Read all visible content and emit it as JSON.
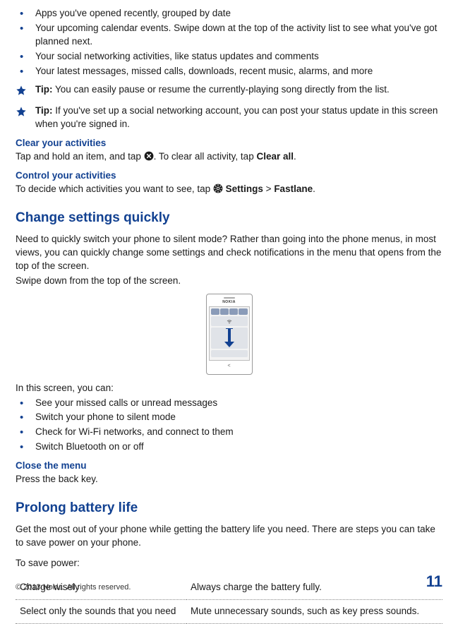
{
  "bullets1": [
    "Apps you've opened recently, grouped by date",
    "Your upcoming calendar events. Swipe down at the top of the activity list to see what you've got planned next.",
    "Your social networking activities, like status updates and comments",
    "Your latest messages, missed calls, downloads, recent music, alarms, and more"
  ],
  "tips": [
    {
      "label": "Tip:",
      "text": " You can easily pause or resume the currently-playing song directly from the list."
    },
    {
      "label": "Tip:",
      "text": " If you've set up a social networking account, you can post your status update in this screen when you're signed in."
    }
  ],
  "clear": {
    "heading": "Clear your activities",
    "line_a": "Tap and hold an item, and tap ",
    "line_b": ". To clear all activity, tap ",
    "clear_all": "Clear all",
    "dot": "."
  },
  "control": {
    "heading": "Control your activities",
    "line_a": "To decide which activities you want to see, tap ",
    "settings": " Settings",
    "gt": " > ",
    "fastlane": "Fastlane",
    "dot": "."
  },
  "change": {
    "heading": "Change settings quickly",
    "intro": "Need to quickly switch your phone to silent mode? Rather than going into the phone menus, in most views, you can quickly change some settings and check notifications in the menu that opens from the top of the screen.",
    "swipe": "Swipe down from the top of the screen.",
    "inthis": "In this screen, you can:",
    "bullets": [
      "See your missed calls or unread messages",
      "Switch your phone to silent mode",
      "Check for Wi-Fi networks, and connect to them",
      "Switch Bluetooth on or off"
    ],
    "close_heading": "Close the menu",
    "close_text": "Press the back key."
  },
  "battery": {
    "heading": "Prolong battery life",
    "intro": "Get the most out of your phone while getting the battery life you need. There are steps you can take to save power on your phone.",
    "tosave": "To save power:",
    "rows": [
      {
        "left": "Charge wisely",
        "right": "Always charge the battery fully."
      },
      {
        "left": "Select only the sounds that you need",
        "right": "Mute unnecessary sounds, such as key press sounds."
      }
    ]
  },
  "phone_logo": "NOKIA",
  "footer": {
    "copyright": "© 2013 Nokia. All rights reserved.",
    "page": "11"
  }
}
